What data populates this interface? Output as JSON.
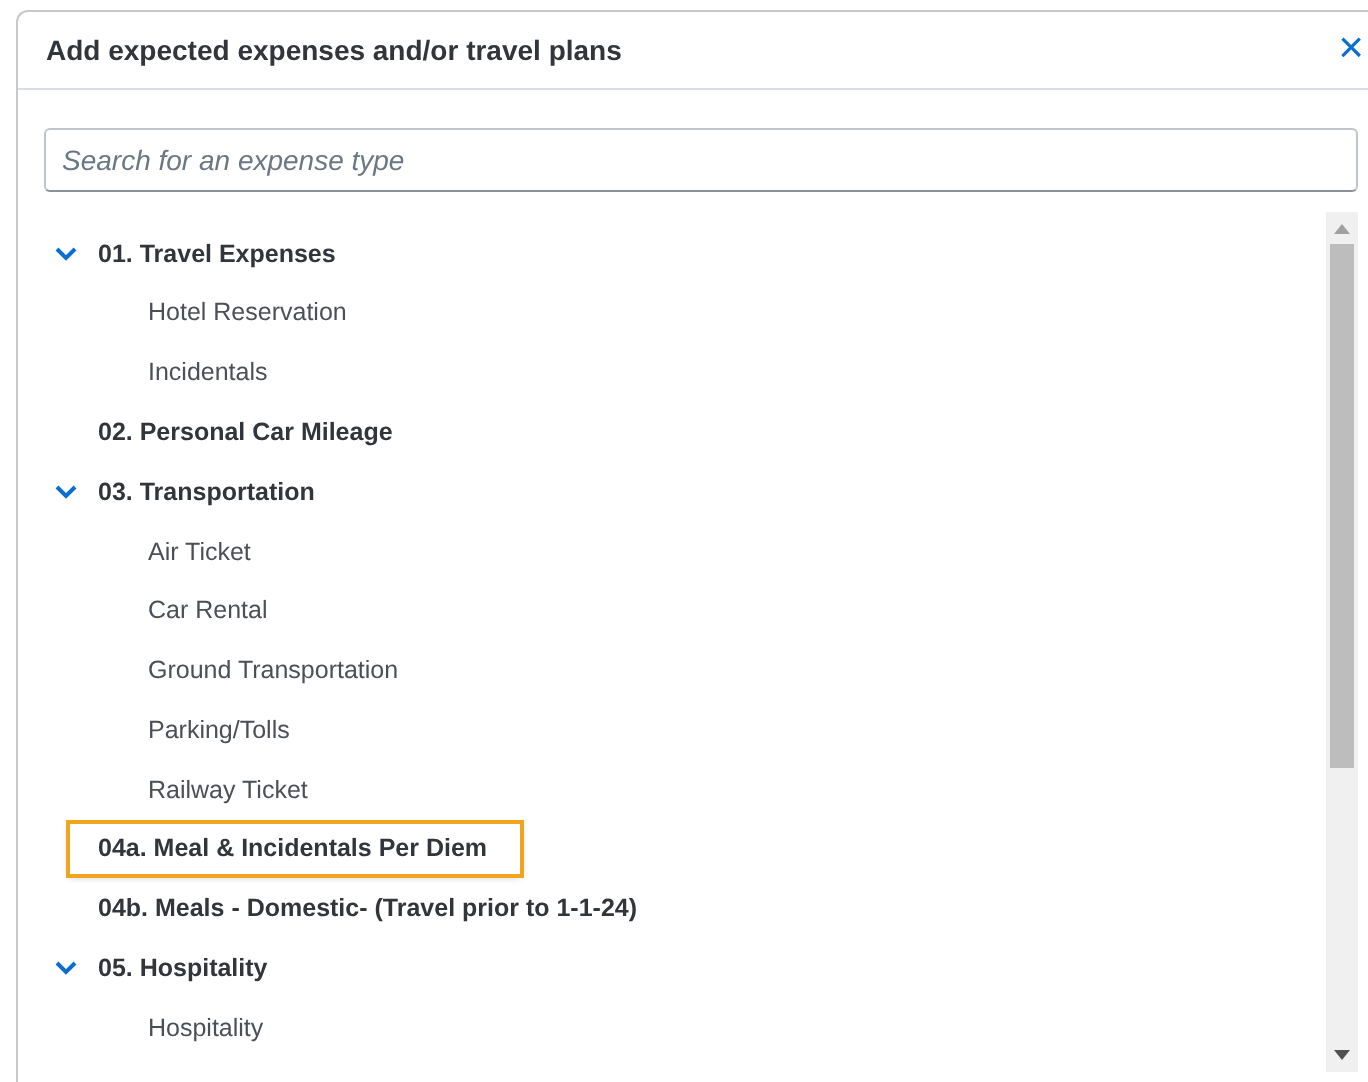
{
  "dialog": {
    "title": "Add expected expenses and/or travel plans",
    "close": "×"
  },
  "search": {
    "placeholder": "Search for an expense type"
  },
  "tree": [
    {
      "label": "01. Travel Expenses",
      "expanded": true,
      "highlighted": false,
      "children": [
        {
          "label": "Hotel Reservation",
          "highlighted": false
        },
        {
          "label": "Incidentals",
          "highlighted": false
        }
      ]
    },
    {
      "label": "02. Personal Car Mileage",
      "highlighted": false
    },
    {
      "label": "03. Transportation",
      "expanded": true,
      "highlighted": false,
      "children": [
        {
          "label": "Air Ticket",
          "highlighted": false
        },
        {
          "label": "Car Rental",
          "highlighted": false
        },
        {
          "label": "Ground Transportation",
          "highlighted": false
        },
        {
          "label": "Parking/Tolls",
          "highlighted": false
        },
        {
          "label": "Railway Ticket",
          "highlighted": false
        }
      ]
    },
    {
      "label": "04a. Meal & Incidentals Per Diem",
      "highlighted": true
    },
    {
      "label": "04b. Meals - Domestic- (Travel prior to 1-1-24)",
      "highlighted": false
    },
    {
      "label": "05. Hospitality",
      "expanded": true,
      "highlighted": false,
      "children": [
        {
          "label": "Hospitality",
          "highlighted": false
        }
      ]
    }
  ]
}
